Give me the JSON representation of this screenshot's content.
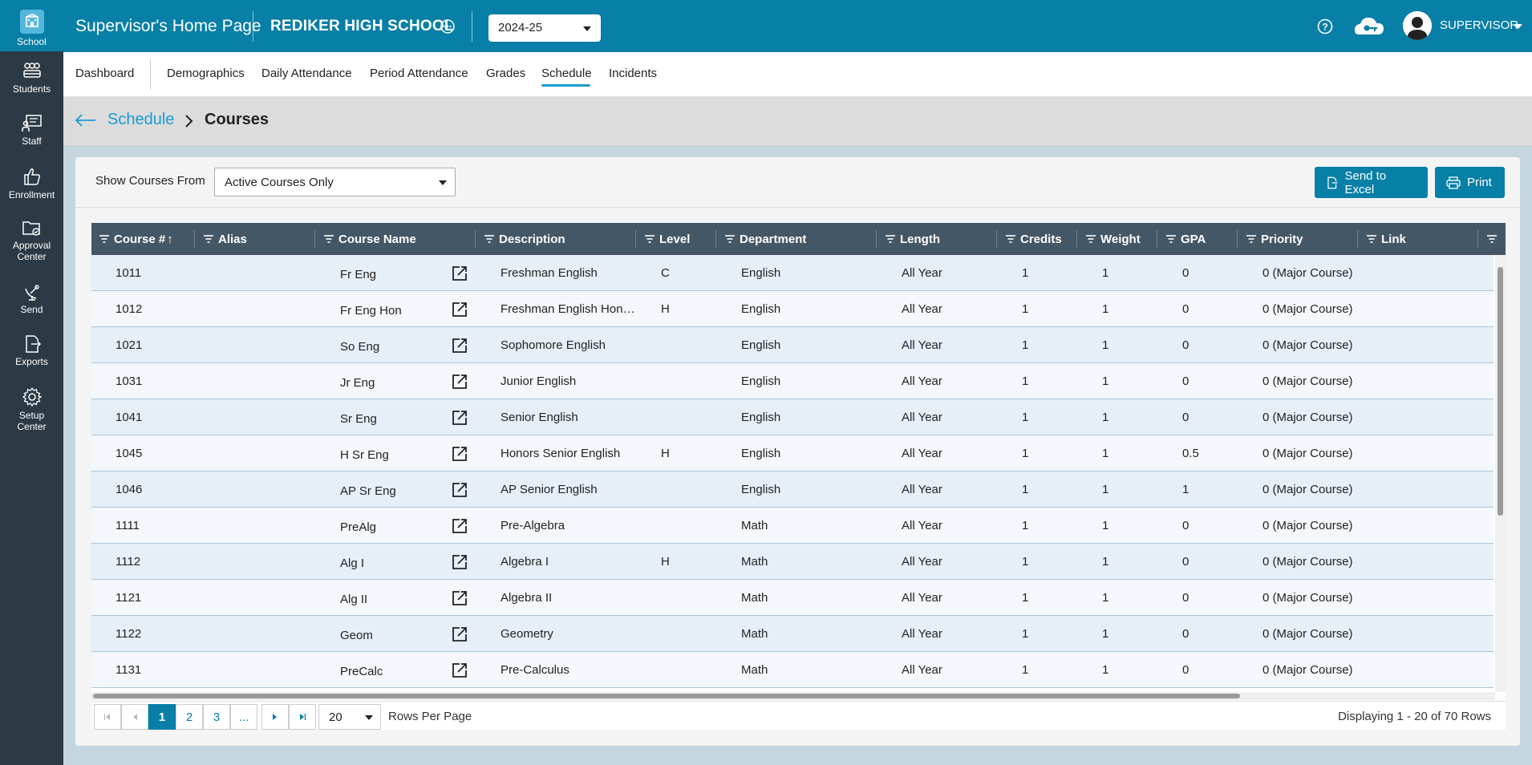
{
  "sidebar": {
    "items": [
      {
        "label": "School",
        "icon": "school-icon"
      },
      {
        "label": "Students",
        "icon": "students-icon"
      },
      {
        "label": "Staff",
        "icon": "staff-icon"
      },
      {
        "label": "Enrollment",
        "icon": "thumbs-up-icon"
      },
      {
        "label": "Approval",
        "label2": "Center",
        "icon": "folder-check-icon"
      },
      {
        "label": "Send",
        "icon": "satellite-icon"
      },
      {
        "label": "Exports",
        "icon": "export-icon"
      },
      {
        "label": "Setup",
        "label2": "Center",
        "icon": "gear-icon"
      }
    ]
  },
  "topbar": {
    "title": "Supervisor's Home Page",
    "school": "REDIKER HIGH SCHOOL",
    "year": "2024-25",
    "user": "SUPERVISOR"
  },
  "nav": {
    "tabs": [
      "Dashboard",
      "Demographics",
      "Daily Attendance",
      "Period Attendance",
      "Grades",
      "Schedule",
      "Incidents"
    ],
    "active": "Schedule"
  },
  "breadcrumb": {
    "parent": "Schedule",
    "current": "Courses"
  },
  "filter": {
    "label": "Show Courses From",
    "value": "Active Courses Only"
  },
  "buttons": {
    "excel": "Send to Excel",
    "print": "Print"
  },
  "grid": {
    "columns": [
      "Course #",
      "Alias",
      "Course Name",
      "Description",
      "Level",
      "Department",
      "Length",
      "Credits",
      "Weight",
      "GPA",
      "Priority",
      "Link"
    ],
    "sort_indicator": "↑",
    "rows": [
      {
        "num": "1011",
        "alias": "",
        "name": "Fr Eng",
        "desc": "Freshman English",
        "level": "C",
        "dept": "English",
        "length": "All Year",
        "credits": "1",
        "weight": "1",
        "gpa": "0",
        "priority": "0 (Major Course)",
        "link": ""
      },
      {
        "num": "1012",
        "alias": "",
        "name": "Fr Eng Hon",
        "desc": "Freshman English Hon…",
        "level": "H",
        "dept": "English",
        "length": "All Year",
        "credits": "1",
        "weight": "1",
        "gpa": "0",
        "priority": "0 (Major Course)",
        "link": ""
      },
      {
        "num": "1021",
        "alias": "",
        "name": "So Eng",
        "desc": "Sophomore English",
        "level": "",
        "dept": "English",
        "length": "All Year",
        "credits": "1",
        "weight": "1",
        "gpa": "0",
        "priority": "0 (Major Course)",
        "link": ""
      },
      {
        "num": "1031",
        "alias": "",
        "name": "Jr Eng",
        "desc": "Junior English",
        "level": "",
        "dept": "English",
        "length": "All Year",
        "credits": "1",
        "weight": "1",
        "gpa": "0",
        "priority": "0 (Major Course)",
        "link": ""
      },
      {
        "num": "1041",
        "alias": "",
        "name": "Sr Eng",
        "desc": "Senior English",
        "level": "",
        "dept": "English",
        "length": "All Year",
        "credits": "1",
        "weight": "1",
        "gpa": "0",
        "priority": "0 (Major Course)",
        "link": ""
      },
      {
        "num": "1045",
        "alias": "",
        "name": "H Sr Eng",
        "desc": "Honors Senior English",
        "level": "H",
        "dept": "English",
        "length": "All Year",
        "credits": "1",
        "weight": "1",
        "gpa": "0.5",
        "priority": "0 (Major Course)",
        "link": ""
      },
      {
        "num": "1046",
        "alias": "",
        "name": "AP Sr Eng",
        "desc": "AP Senior English",
        "level": "",
        "dept": "English",
        "length": "All Year",
        "credits": "1",
        "weight": "1",
        "gpa": "1",
        "priority": "0 (Major Course)",
        "link": ""
      },
      {
        "num": "1111",
        "alias": "",
        "name": "PreAlg",
        "desc": "Pre-Algebra",
        "level": "",
        "dept": "Math",
        "length": "All Year",
        "credits": "1",
        "weight": "1",
        "gpa": "0",
        "priority": "0 (Major Course)",
        "link": ""
      },
      {
        "num": "1112",
        "alias": "",
        "name": "Alg I",
        "desc": "Algebra I",
        "level": "H",
        "dept": "Math",
        "length": "All Year",
        "credits": "1",
        "weight": "1",
        "gpa": "0",
        "priority": "0 (Major Course)",
        "link": ""
      },
      {
        "num": "1121",
        "alias": "",
        "name": "Alg II",
        "desc": "Algebra II",
        "level": "",
        "dept": "Math",
        "length": "All Year",
        "credits": "1",
        "weight": "1",
        "gpa": "0",
        "priority": "0 (Major Course)",
        "link": ""
      },
      {
        "num": "1122",
        "alias": "",
        "name": "Geom",
        "desc": "Geometry",
        "level": "",
        "dept": "Math",
        "length": "All Year",
        "credits": "1",
        "weight": "1",
        "gpa": "0",
        "priority": "0 (Major Course)",
        "link": ""
      },
      {
        "num": "1131",
        "alias": "",
        "name": "PreCalc",
        "desc": "Pre-Calculus",
        "level": "",
        "dept": "Math",
        "length": "All Year",
        "credits": "1",
        "weight": "1",
        "gpa": "0",
        "priority": "0 (Major Course)",
        "link": ""
      }
    ]
  },
  "pager": {
    "pages": [
      "1",
      "2",
      "3",
      "..."
    ],
    "active_page": "1",
    "rows_per_page": "20",
    "rows_per_page_label": "Rows Per Page",
    "display_text": "Displaying 1 - 20 of 70 Rows"
  },
  "colors": {
    "topbar": "#087fa6",
    "sidebar": "#2b3a45",
    "grid_header": "#445766",
    "accent": "#1a9bd2"
  }
}
